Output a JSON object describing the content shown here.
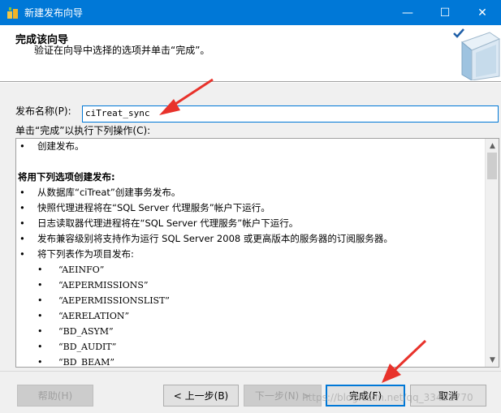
{
  "window": {
    "title": "新建发布向导",
    "controls": {
      "minimize": "—",
      "maximize": "☐",
      "close": "✕"
    }
  },
  "header": {
    "title": "完成该向导",
    "subtitle": "验证在向导中选择的选项并单击“完成”。"
  },
  "form": {
    "name_label": "发布名称(P):",
    "name_value": "ciTreat_sync",
    "actions_label": "单击“完成”以执行下列操作(C):"
  },
  "actions": {
    "create": "创建发布。",
    "section_title": "将用下列选项创建发布:",
    "items": [
      "从数据库“ciTreat”创建事务发布。",
      "快照代理进程将在“SQL Server 代理服务”帐户下运行。",
      "日志读取器代理进程将在“SQL Server 代理服务”帐户下运行。",
      "发布兼容级别将支持作为运行 SQL Server 2008 或更高版本的服务器的订阅服务器。",
      "将下列表作为项目发布:"
    ],
    "articles": [
      "“AEINFO”",
      "“AEPERMISSIONS”",
      "“AEPERMISSIONSLIST”",
      "“AERELATION”",
      "“BD_ASYM”",
      "“BD_AUDIT”",
      "“BD_BEAM”"
    ]
  },
  "buttons": {
    "help": "帮助(H)",
    "back": "< 上一步(B)",
    "next": "下一步(N) >",
    "finish": "完成(F)",
    "cancel": "取消"
  },
  "watermark": "https://blog.csdn.net/qq_33492770",
  "colors": {
    "titlebar": "#0078d7",
    "annotation_arrow": "#e8322b"
  }
}
